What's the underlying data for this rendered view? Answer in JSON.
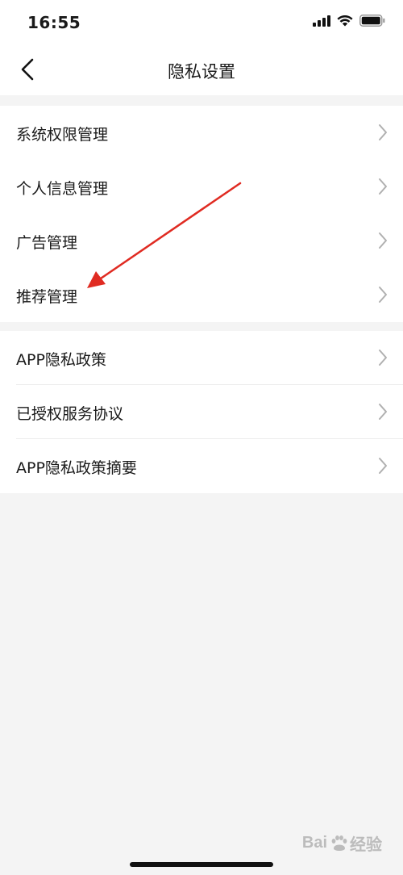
{
  "status_bar": {
    "time": "16:55"
  },
  "nav": {
    "title": "隐私设置"
  },
  "groups": [
    {
      "items": [
        {
          "label": "系统权限管理"
        },
        {
          "label": "个人信息管理"
        },
        {
          "label": "广告管理"
        },
        {
          "label": "推荐管理"
        }
      ]
    },
    {
      "items": [
        {
          "label": "APP隐私政策"
        },
        {
          "label": "已授权服务协议"
        },
        {
          "label": "APP隐私政策摘要"
        }
      ]
    }
  ],
  "watermark": {
    "text_a": "Bai",
    "text_b": "经验"
  },
  "colors": {
    "background": "#f4f4f4",
    "surface": "#ffffff",
    "chevron": "#b0b0b0",
    "annotation_arrow": "#e02b22"
  }
}
